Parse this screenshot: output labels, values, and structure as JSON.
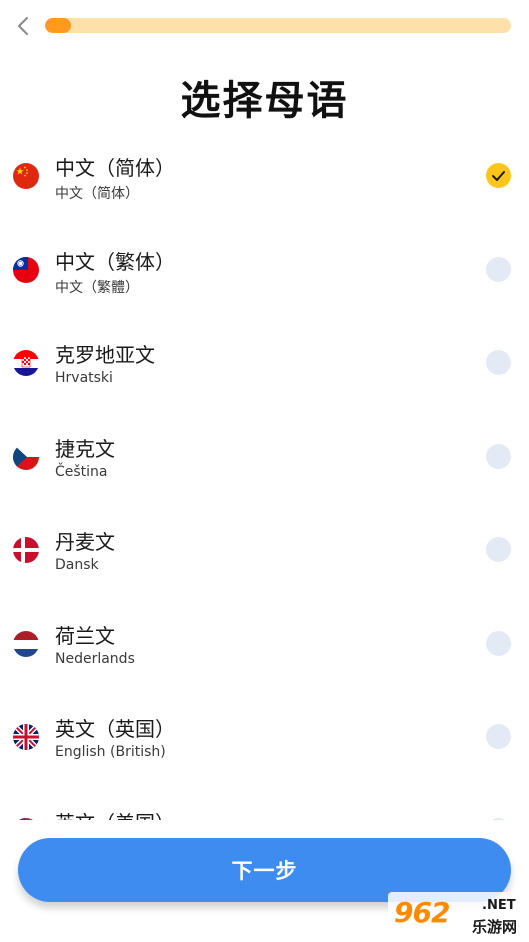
{
  "header": {
    "back_icon": "chevron-left-icon",
    "progress": 0.055,
    "progress_track_color": "#ffe0a8",
    "progress_fill_color": "#ff9a1f"
  },
  "title": "选择母语",
  "languages": [
    {
      "name": "中文（简体）",
      "native": "中文（简体）",
      "flag": "china-flag-icon",
      "selected": true
    },
    {
      "name": "中文（繁体）",
      "native": "中文（繁體）",
      "flag": "taiwan-flag-icon",
      "selected": false
    },
    {
      "name": "克罗地亚文",
      "native": "Hrvatski",
      "flag": "croatia-flag-icon",
      "selected": false
    },
    {
      "name": "捷克文",
      "native": "Čeština",
      "flag": "czech-flag-icon",
      "selected": false
    },
    {
      "name": "丹麦文",
      "native": "Dansk",
      "flag": "denmark-flag-icon",
      "selected": false
    },
    {
      "name": "荷兰文",
      "native": "Nederlands",
      "flag": "netherlands-flag-icon",
      "selected": false
    },
    {
      "name": "英文（英国）",
      "native": "English (British)",
      "flag": "uk-flag-icon",
      "selected": false
    },
    {
      "name": "英文（美国）",
      "native": "",
      "flag": "us-flag-icon",
      "selected": false
    }
  ],
  "selected_color": "#ffc619",
  "unselected_color": "#e3eaf5",
  "next_button": {
    "label": "下一步",
    "color": "#3e8cf0"
  },
  "watermark": {
    "logo": "962",
    "net": ".NET",
    "text": "乐游网"
  }
}
